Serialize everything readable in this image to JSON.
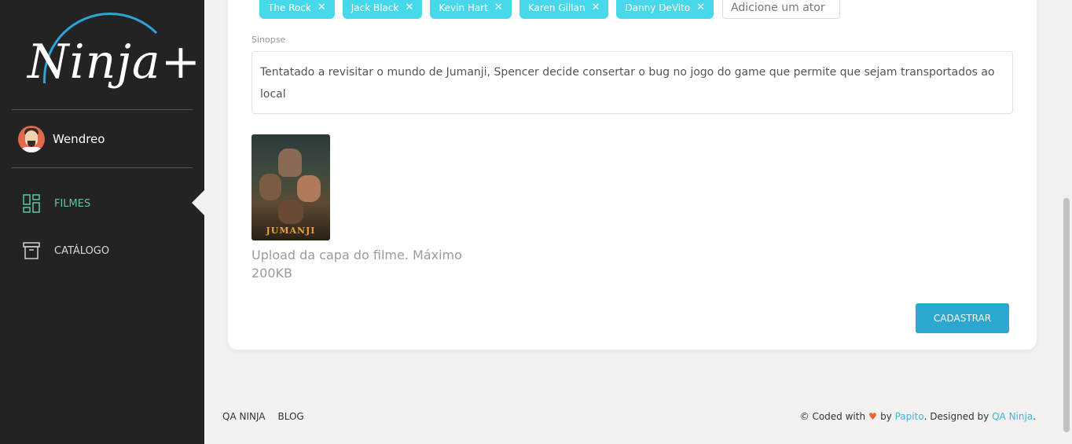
{
  "brand": {
    "logo_text": "Ninja+"
  },
  "user": {
    "name": "Wendreo"
  },
  "nav": [
    {
      "label": "FILMES",
      "active": true,
      "icon": "dashboard-grid-icon"
    },
    {
      "label": "CATÁLOGO",
      "active": false,
      "icon": "archive-box-icon"
    }
  ],
  "form": {
    "actors": [
      "The Rock",
      "Jack Black",
      "Kevin Hart",
      "Karen Gillan",
      "Danny DeVito"
    ],
    "actor_placeholder": "Adicione um ator",
    "synopsis_label": "Sinopse",
    "synopsis_value": "Tentatado a revisitar o mundo de Jumanji, Spencer decide consertar o bug no jogo do game que permite que sejam transportados ao local",
    "poster_title": "JUMANJI",
    "upload_hint": "Upload da capa do filme. Máximo 200KB",
    "submit_label": "CADASTRAR"
  },
  "footer": {
    "links": [
      "QA NINJA",
      "BLOG"
    ],
    "credit_prefix": "© Coded with",
    "credit_by": "by",
    "author": "Papito",
    "designed_by": ". Designed by",
    "designer": "QA Ninja",
    "end": "."
  },
  "colors": {
    "sidebar_bg": "#232323",
    "accent_green": "#5ec79b",
    "tag_bg": "#47d9ea",
    "button_bg": "#2ca7cf",
    "link": "#3fb7d8",
    "heart": "#e8652b"
  }
}
